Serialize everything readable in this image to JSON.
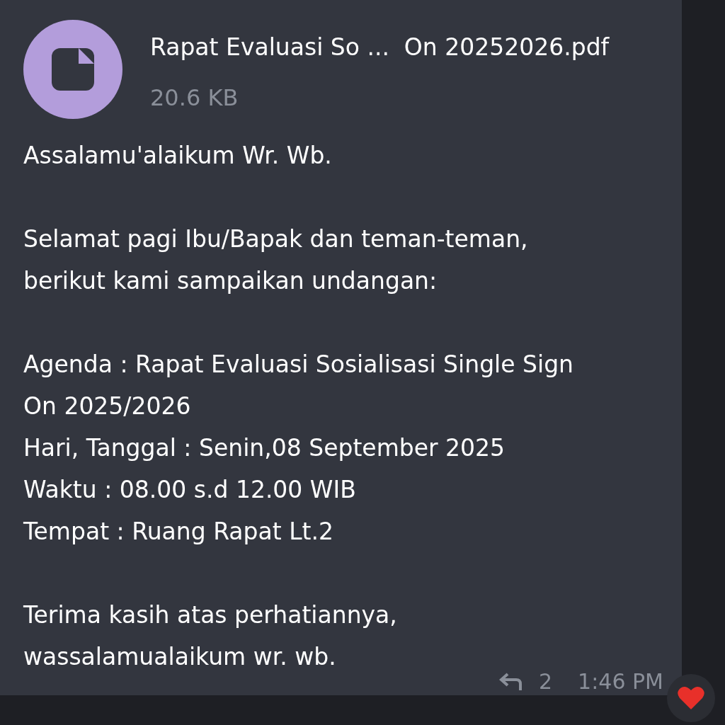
{
  "file": {
    "name": "Rapat Evaluasi So ...  On 20252026.pdf",
    "size": "20.6 KB"
  },
  "message": {
    "paragraphs": [
      [
        "Assalamu'alaikum Wr. Wb."
      ],
      [
        "Selamat pagi Ibu/Bapak dan teman-teman,",
        "berikut kami sampaikan undangan:"
      ],
      [
        "Agenda : Rapat Evaluasi Sosialisasi Single Sign",
        "On 2025/2026",
        "Hari, Tanggal : Senin,08 September 2025",
        "Waktu : 08.00 s.d 12.00 WIB",
        "Tempat : Ruang Rapat Lt.2"
      ],
      [
        "Terima kasih atas perhatiannya,",
        "wassalamualaikum wr. wb."
      ]
    ]
  },
  "footer": {
    "replies": "2",
    "time": "1:46 PM"
  }
}
